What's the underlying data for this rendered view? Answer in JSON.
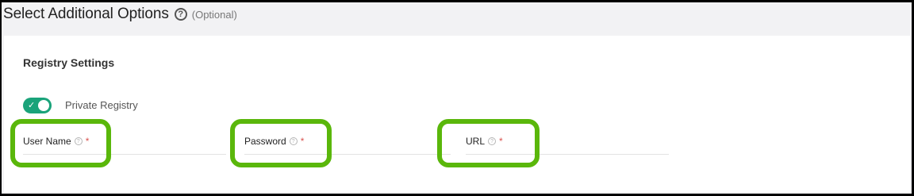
{
  "header": {
    "title": "Select Additional Options",
    "help_icon": "question-circle-icon",
    "optional_label": "(Optional)"
  },
  "registry": {
    "section_title": "Registry Settings",
    "private_registry": {
      "label": "Private Registry",
      "enabled": true,
      "check_glyph": "✓",
      "color": "#1aa37a"
    },
    "fields": [
      {
        "label": "User Name",
        "required_mark": "*",
        "help_glyph": "?"
      },
      {
        "label": "Password",
        "required_mark": "*",
        "help_glyph": "?"
      },
      {
        "label": "URL",
        "required_mark": "*",
        "help_glyph": "?"
      }
    ]
  },
  "colors": {
    "highlight": "#5ab70b",
    "required": "#d9534f"
  }
}
